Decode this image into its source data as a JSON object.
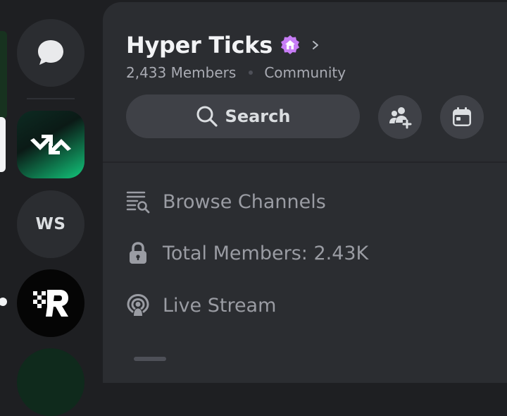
{
  "server": {
    "name": "Hyper Ticks",
    "members_count": "2,433 Members",
    "type": "Community"
  },
  "search": {
    "label": "Search"
  },
  "rail": {
    "servers": [
      {
        "name": "direct-messages",
        "icon": "chat-bubble-icon"
      },
      {
        "name": "hyper-ticks",
        "icon": "hyper-ticks-logo"
      },
      {
        "name": "ws",
        "label": "WS"
      },
      {
        "name": "r-server",
        "icon": "r-logo"
      }
    ]
  },
  "menu": {
    "browse": "Browse Channels",
    "members": "Total Members: 2.43K",
    "live": "Live Stream"
  },
  "colors": {
    "background": "#1e1f22",
    "panel": "#2b2d31",
    "button": "#3f4147",
    "badge": "#c77df5",
    "text_muted": "#9a9ca3",
    "accent_green": "#12c77b"
  }
}
